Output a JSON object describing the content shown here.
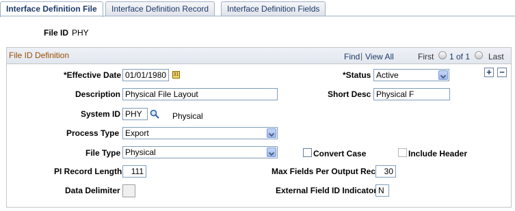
{
  "tabs": [
    {
      "label": "Interface Definition File",
      "active": true
    },
    {
      "label": "Interface Definition Record",
      "active": false
    },
    {
      "label": "Interface Definition Fields",
      "active": false
    }
  ],
  "file_id": {
    "label": "File ID",
    "value": "PHY"
  },
  "section": {
    "title": "File ID Definition",
    "find": "Find",
    "separator": "|",
    "view_all": "View All",
    "first": "First",
    "range": "1 of 1",
    "last": "Last"
  },
  "fields": {
    "effective_date": {
      "label": "*Effective Date",
      "value": "01/01/1980"
    },
    "status": {
      "label": "*Status",
      "value": "Active"
    },
    "description": {
      "label": "Description",
      "value": "Physical File Layout"
    },
    "short_desc": {
      "label": "Short Desc",
      "value": "Physical F"
    },
    "system_id": {
      "label": "System ID",
      "value": "PHY",
      "desc": "Physical"
    },
    "process_type": {
      "label": "Process Type",
      "value": "Export"
    },
    "file_type": {
      "label": "File Type",
      "value": "Physical"
    },
    "convert_case": {
      "label": "Convert Case",
      "checked": false
    },
    "include_header": {
      "label": "Include Header",
      "checked": false
    },
    "pi_record_length": {
      "label": "PI Record Length",
      "value": "111"
    },
    "max_fields": {
      "label": "Max Fields Per Output Rec",
      "value": "30"
    },
    "data_delimiter": {
      "label": "Data Delimiter",
      "value": ""
    },
    "external_field_id": {
      "label": "External Field ID Indicator",
      "value": "N"
    }
  },
  "icons": {
    "calendar": "calendar-icon",
    "lookup": "magnifier-icon",
    "add_row": "+",
    "delete_row": "−",
    "prev": "left-arrow-icon",
    "next": "right-arrow-icon"
  },
  "colors": {
    "link": "#1d3868",
    "section_title": "#994d00"
  }
}
